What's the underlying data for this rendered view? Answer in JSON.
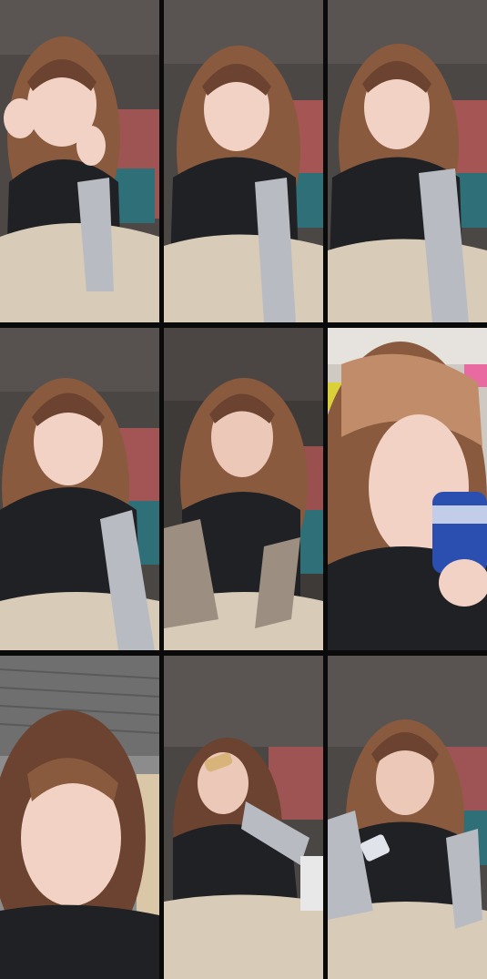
{
  "frames": [
    {
      "id": 1,
      "scene": "van-interior",
      "pose": "hand-gesture"
    },
    {
      "id": 2,
      "scene": "van-interior",
      "pose": "talking"
    },
    {
      "id": 3,
      "scene": "van-interior",
      "pose": "talking"
    },
    {
      "id": 4,
      "scene": "van-interior",
      "pose": "pouting"
    },
    {
      "id": 5,
      "scene": "van-interior",
      "pose": "looking-down"
    },
    {
      "id": 6,
      "scene": "van-interior-closeup",
      "pose": "drinking-can"
    },
    {
      "id": 7,
      "scene": "station-closeup",
      "pose": "looking-up"
    },
    {
      "id": 8,
      "scene": "van-interior",
      "pose": "drinking-bottle"
    },
    {
      "id": 9,
      "scene": "van-interior",
      "pose": "holding-snack"
    }
  ],
  "colors": {
    "background": "#0a0a0a",
    "hair": "#8a5a3e",
    "hair_light": "#c08c6a",
    "skin": "#f1d2c4",
    "vest": "#1f2124",
    "sleeve": "#b8bcc2",
    "pants": "#d8ccb8",
    "ceiling": "#4a4644",
    "seat_red": "#c25a5a",
    "seat_teal": "#2e6f78",
    "can_blue": "#2a4fb0"
  }
}
